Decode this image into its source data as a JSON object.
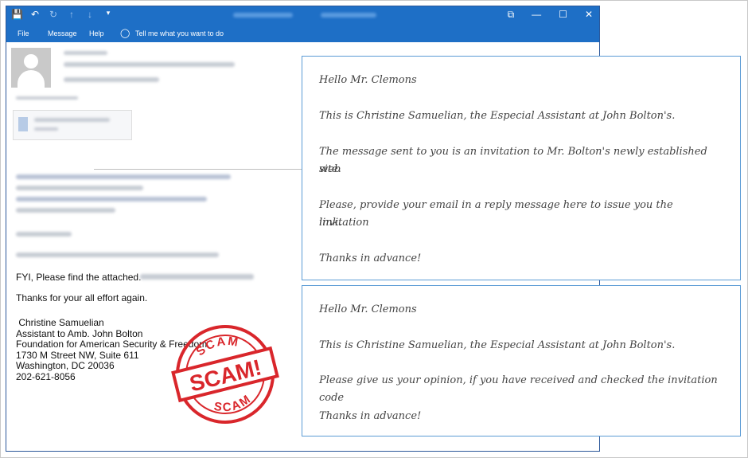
{
  "app": {
    "quick_access": [
      "save-icon",
      "undo-icon",
      "redo-icon",
      "up-arrow-icon",
      "down-arrow-icon",
      "customize-icon"
    ],
    "window_controls": {
      "restore": "⧉",
      "minimize": "—",
      "maximize": "☐",
      "close": "✕"
    },
    "menu": {
      "file": "File",
      "message": "Message",
      "help": "Help",
      "tell_me": "Tell me what you want to do"
    },
    "accent": "#1e6fc6"
  },
  "email": {
    "fyi": "FYI, Please find the attached.",
    "thanks": "Thanks for your all effort again.",
    "signature": [
      " Christine Samuelian",
      "Assistant to Amb. John Bolton",
      "Foundation for American Security & Freedom",
      "1730 M Street NW, Suite 611",
      "Washington, DC  20036",
      "202-621-8056"
    ]
  },
  "stamp": {
    "top": "SCAM",
    "center": "SCAM!",
    "bottom": "SCAM",
    "color": "#d9262b"
  },
  "callout_1": [
    "Hello Mr. Clemons",
    "This is Christine Samuelian, the Especial Assistant at John Bolton's.",
    "The message sent to you is an invitation to Mr. Bolton's newly established web",
    "site.",
    "Please, provide your email in a reply message here to issue you the invitation",
    "link.",
    "Thanks in advance!"
  ],
  "callout_2": [
    "Hello Mr. Clemons",
    "This is Christine Samuelian, the Especial Assistant at John Bolton's.",
    "Please give us your opinion, if you have received and checked the invitation code",
    "Thanks in advance!"
  ]
}
